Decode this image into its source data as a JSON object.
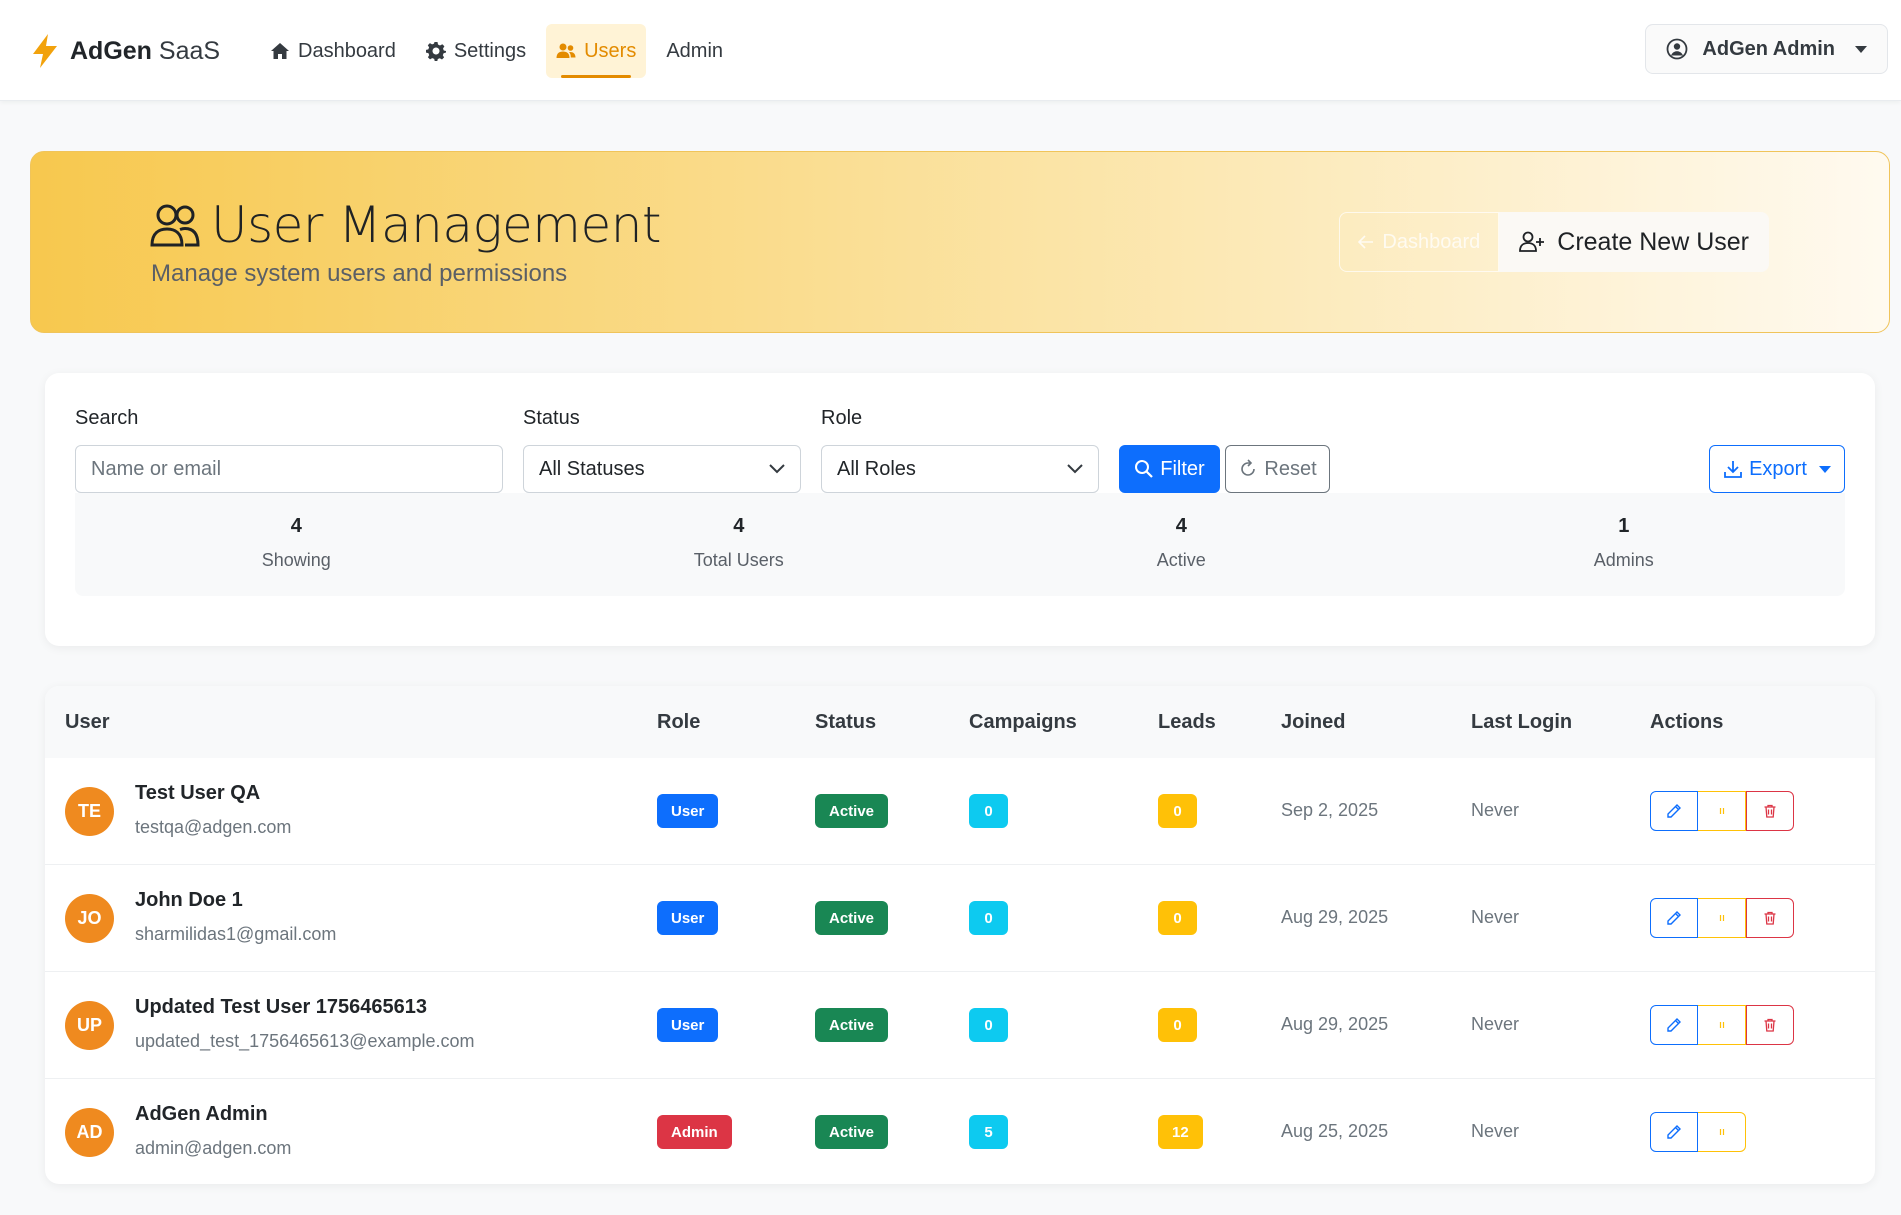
{
  "brand": {
    "name_bold": "AdGen",
    "name_light": "SaaS"
  },
  "nav": [
    {
      "label": "Dashboard",
      "icon": "home-icon"
    },
    {
      "label": "Settings",
      "icon": "gear-icon"
    },
    {
      "label": "Users",
      "icon": "users-icon",
      "active": true
    },
    {
      "label": "Admin",
      "icon": ""
    }
  ],
  "user_menu": {
    "label": "AdGen Admin"
  },
  "hero": {
    "title": "User Management",
    "subtitle": "Manage system users and permissions",
    "back_label": "Dashboard",
    "create_label": "Create New User"
  },
  "filters": {
    "search_label": "Search",
    "search_placeholder": "Name or email",
    "status_label": "Status",
    "status_value": "All Statuses",
    "role_label": "Role",
    "role_value": "All Roles",
    "filter_btn": "Filter",
    "reset_btn": "Reset",
    "export_btn": "Export"
  },
  "stats": [
    {
      "value": "4",
      "label": "Showing"
    },
    {
      "value": "4",
      "label": "Total Users"
    },
    {
      "value": "4",
      "label": "Active"
    },
    {
      "value": "1",
      "label": "Admins"
    }
  ],
  "table": {
    "headers": {
      "user": "User",
      "role": "Role",
      "status": "Status",
      "campaigns": "Campaigns",
      "leads": "Leads",
      "joined": "Joined",
      "last_login": "Last Login",
      "actions": "Actions"
    },
    "rows": [
      {
        "initials": "TE",
        "name": "Test User QA",
        "email": "testqa@adgen.com",
        "role": "User",
        "status": "Active",
        "campaigns": "0",
        "leads": "0",
        "joined": "Sep 2, 2025",
        "last_login": "Never"
      },
      {
        "initials": "JO",
        "name": "John Doe 1",
        "email": "sharmilidas1@gmail.com",
        "role": "User",
        "status": "Active",
        "campaigns": "0",
        "leads": "0",
        "joined": "Aug 29, 2025",
        "last_login": "Never"
      },
      {
        "initials": "UP",
        "name": "Updated Test User 1756465613",
        "email": "updated_test_1756465613@example.com",
        "role": "User",
        "status": "Active",
        "campaigns": "0",
        "leads": "0",
        "joined": "Aug 29, 2025",
        "last_login": "Never"
      },
      {
        "initials": "AD",
        "name": "AdGen Admin",
        "email": "admin@adgen.com",
        "role": "Admin",
        "status": "Active",
        "campaigns": "5",
        "leads": "12",
        "joined": "Aug 25, 2025",
        "last_login": "Never"
      }
    ]
  },
  "colors": {
    "accent": "#e38b00",
    "primary": "#0d6efd",
    "success": "#198754",
    "danger": "#dc3545",
    "info": "#0dcaf0",
    "warning": "#ffc107",
    "avatar": "#ef8a1f"
  }
}
